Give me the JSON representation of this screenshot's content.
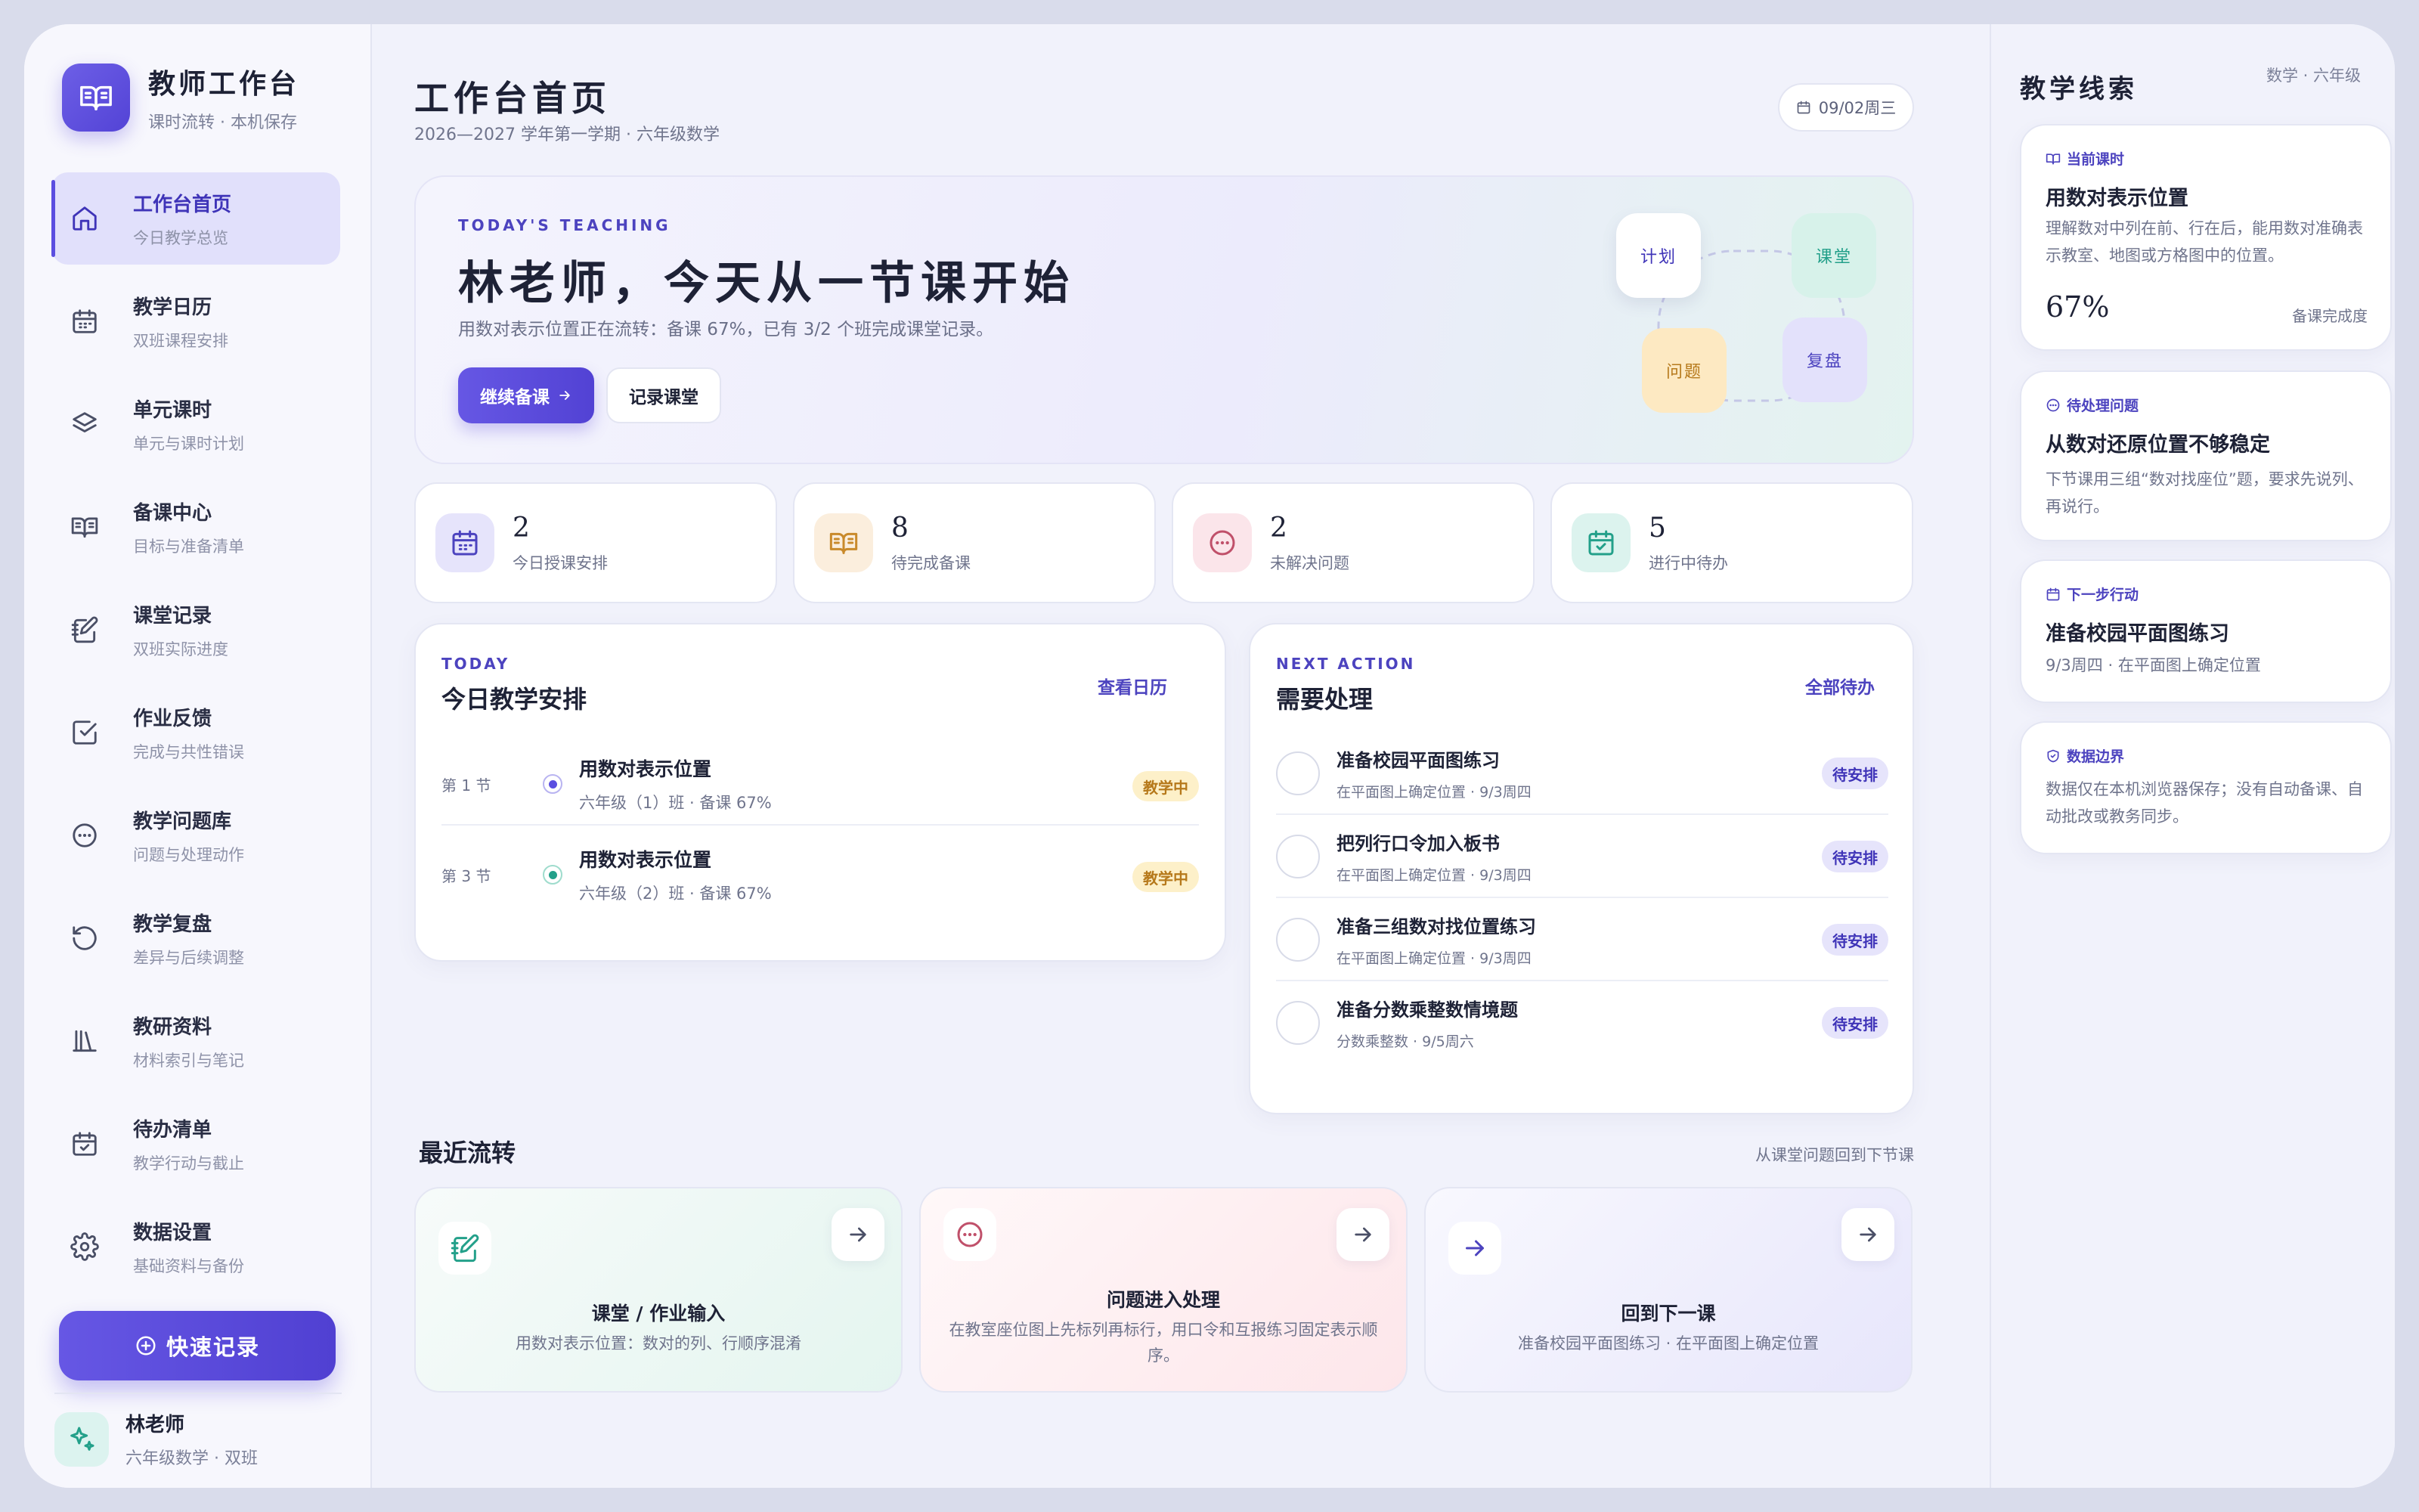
{
  "brand": {
    "title": "教师工作台",
    "subtitle": "课时流转 · 本机保存"
  },
  "sidebar": {
    "items": [
      {
        "label": "工作台首页",
        "desc": "今日教学总览",
        "icon": "home-icon",
        "active": true
      },
      {
        "label": "教学日历",
        "desc": "双班课程安排",
        "icon": "calendar-icon"
      },
      {
        "label": "单元课时",
        "desc": "单元与课时计划",
        "icon": "layers-icon"
      },
      {
        "label": "备课中心",
        "desc": "目标与准备清单",
        "icon": "open-book-icon"
      },
      {
        "label": "课堂记录",
        "desc": "双班实际进度",
        "icon": "notebook-pen-icon"
      },
      {
        "label": "作业反馈",
        "desc": "完成与共性错误",
        "icon": "checkbox-icon"
      },
      {
        "label": "教学问题库",
        "desc": "问题与处理动作",
        "icon": "ellipsis-circle-icon"
      },
      {
        "label": "教学复盘",
        "desc": "差异与后续调整",
        "icon": "rotate-icon"
      },
      {
        "label": "教研资料",
        "desc": "材料索引与笔记",
        "icon": "library-icon"
      },
      {
        "label": "待办清单",
        "desc": "教学行动与截止",
        "icon": "calendar-check-icon"
      },
      {
        "label": "数据设置",
        "desc": "基础资料与备份",
        "icon": "gear-icon"
      }
    ],
    "quick_label": "快速记录"
  },
  "user": {
    "name": "林老师",
    "role": "六年级数学 · 双班"
  },
  "header": {
    "title": "工作台首页",
    "subtitle": "2026—2027 学年第一学期 · 六年级数学",
    "date": "09/02周三"
  },
  "hero": {
    "eyebrow": "TODAY'S TEACHING",
    "title": "林老师，今天从一节课开始",
    "desc": "用数对表示位置正在流转：备课 67%，已有 3/2 个班完成课堂记录。",
    "primary": "继续备课",
    "secondary": "记录课堂",
    "nodes": [
      "计划",
      "课堂",
      "问题",
      "复盘"
    ]
  },
  "stats": [
    {
      "value": "2",
      "label": "今日授课安排"
    },
    {
      "value": "8",
      "label": "待完成备课"
    },
    {
      "value": "2",
      "label": "未解决问题"
    },
    {
      "value": "5",
      "label": "进行中待办"
    }
  ],
  "schedule": {
    "eyebrow": "TODAY",
    "title": "今日教学安排",
    "link": "查看日历",
    "rows": [
      {
        "period": "第 1 节",
        "title": "用数对表示位置",
        "meta": "六年级（1）班 · 备课 67%",
        "badge": "教学中"
      },
      {
        "period": "第 3 节",
        "title": "用数对表示位置",
        "meta": "六年级（2）班 · 备课 67%",
        "badge": "教学中"
      }
    ]
  },
  "actions": {
    "eyebrow": "NEXT ACTION",
    "title": "需要处理",
    "link": "全部待办",
    "rows": [
      {
        "title": "准备校园平面图练习",
        "meta": "在平面图上确定位置 · 9/3周四",
        "badge": "待安排"
      },
      {
        "title": "把列行口令加入板书",
        "meta": "在平面图上确定位置 · 9/3周四",
        "badge": "待安排"
      },
      {
        "title": "准备三组数对找位置练习",
        "meta": "在平面图上确定位置 · 9/3周四",
        "badge": "待安排"
      },
      {
        "title": "准备分数乘整数情境题",
        "meta": "分数乘整数 · 9/5周六",
        "badge": "待安排"
      }
    ]
  },
  "recent": {
    "title": "最近流转",
    "note": "从课堂问题回到下节课",
    "cards": [
      {
        "title": "课堂 / 作业输入",
        "desc": "用数对表示位置：数对的列、行顺序混淆"
      },
      {
        "title": "问题进入处理",
        "desc": "在教室座位图上先标列再标行，用口令和互报练习固定表示顺序。"
      },
      {
        "title": "回到下一课",
        "desc": "准备校园平面图练习 · 在平面图上确定位置"
      }
    ]
  },
  "clues": {
    "title": "教学线索",
    "tag": "数学 · 六年级",
    "current": {
      "eyebrow": "当前课时",
      "title": "用数对表示位置",
      "desc": "理解数对中列在前、行在后，能用数对准确表示教室、地图或方格图中的位置。",
      "percent": "67%",
      "percent_label": "备课完成度"
    },
    "problem": {
      "eyebrow": "待处理问题",
      "title": "从数对还原位置不够稳定",
      "desc": "下节课用三组“数对找座位”题，要求先说列、再说行。"
    },
    "next": {
      "eyebrow": "下一步行动",
      "title": "准备校园平面图练习",
      "desc": "9/3周四 · 在平面图上确定位置"
    },
    "boundary": {
      "eyebrow": "数据边界",
      "desc": "数据仅在本机浏览器保存；没有自动备课、自动批改或教务同步。"
    }
  },
  "colors": {
    "accent": "#5b4ee0",
    "teal": "#23a08a",
    "orange": "#c98a2b",
    "rose": "#c0506a"
  }
}
